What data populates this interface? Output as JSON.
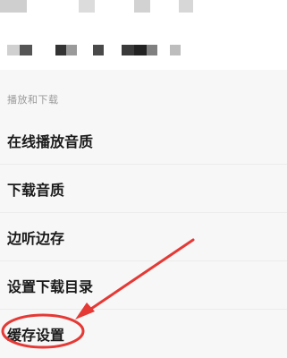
{
  "section": {
    "header": "播放和下载"
  },
  "items": [
    {
      "label": "在线播放音质"
    },
    {
      "label": "下载音质"
    },
    {
      "label": "边听边存"
    },
    {
      "label": "设置下载目录"
    },
    {
      "label": "缓存设置"
    }
  ],
  "annotation": {
    "color": "#e53935",
    "highlighted_item": "缓存设置"
  }
}
